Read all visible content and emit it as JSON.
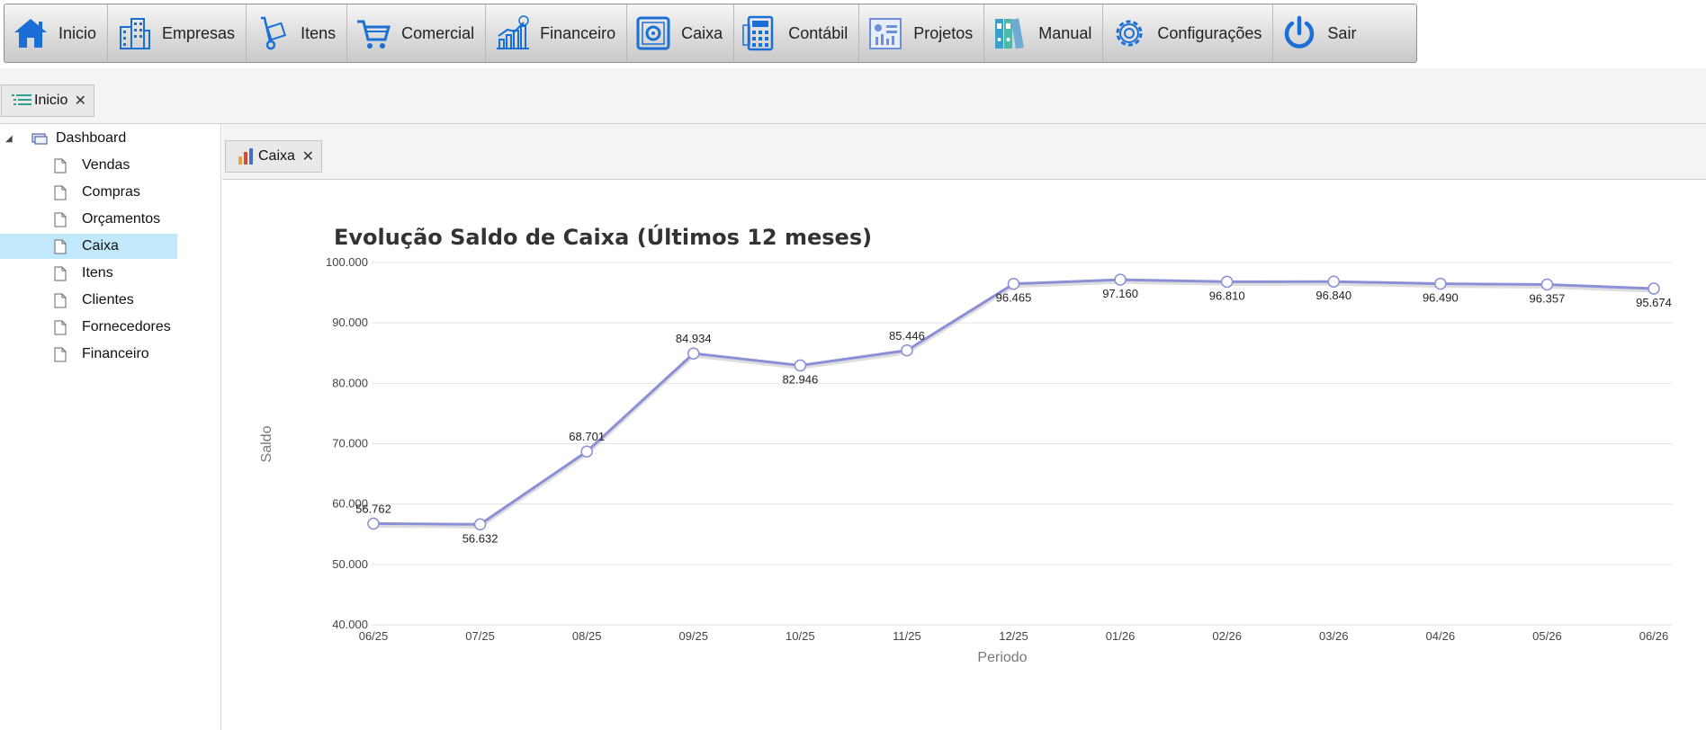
{
  "menubar": {
    "items": [
      {
        "label": "Inicio",
        "icon": "home-icon"
      },
      {
        "label": "Empresas",
        "icon": "buildings-icon"
      },
      {
        "label": "Itens",
        "icon": "hand-truck-icon"
      },
      {
        "label": "Comercial",
        "icon": "shopping-cart-icon"
      },
      {
        "label": "Financeiro",
        "icon": "growth-chart-icon"
      },
      {
        "label": "Caixa",
        "icon": "safe-icon"
      },
      {
        "label": "Contábil",
        "icon": "calculator-icon"
      },
      {
        "label": "Projetos",
        "icon": "project-board-icon"
      },
      {
        "label": "Manual",
        "icon": "binders-icon"
      },
      {
        "label": "Configurações",
        "icon": "gear-icon"
      },
      {
        "label": "Sair",
        "icon": "power-icon"
      }
    ]
  },
  "doc_tabs": [
    {
      "label": "Inicio",
      "icon": "list-icon"
    }
  ],
  "tree": {
    "root": {
      "label": "Dashboard",
      "icon": "dashboard-icon",
      "expanded": true
    },
    "children": [
      {
        "label": "Vendas",
        "selected": false
      },
      {
        "label": "Compras",
        "selected": false
      },
      {
        "label": "Orçamentos",
        "selected": false
      },
      {
        "label": "Caixa",
        "selected": true
      },
      {
        "label": "Itens",
        "selected": false
      },
      {
        "label": "Clientes",
        "selected": false
      },
      {
        "label": "Fornecedores",
        "selected": false
      },
      {
        "label": "Financeiro",
        "selected": false
      }
    ]
  },
  "chart_tab": {
    "label": "Caixa",
    "icon": "bar-chart-icon"
  },
  "chart_data": {
    "type": "line",
    "title": "Evolução Saldo de Caixa (Últimos 12 meses)",
    "xlabel": "Periodo",
    "ylabel": "Saldo",
    "categories": [
      "06/25",
      "07/25",
      "08/25",
      "09/25",
      "10/25",
      "11/25",
      "12/25",
      "01/26",
      "02/26",
      "03/26",
      "04/26",
      "05/26",
      "06/26"
    ],
    "values": [
      56762,
      56632,
      68701,
      84934,
      82946,
      85446,
      96465,
      97160,
      96810,
      96840,
      96490,
      96357,
      95674
    ],
    "value_labels": [
      "56.762",
      "56.632",
      "68.701",
      "84.934",
      "82.946",
      "85.446",
      "96.465",
      "97.160",
      "96.810",
      "96.840",
      "96.490",
      "96.357",
      "95.674"
    ],
    "ylim": [
      40000,
      100000
    ],
    "yticks": [
      40000,
      50000,
      60000,
      70000,
      80000,
      90000,
      100000
    ],
    "ytick_labels": [
      "40.000",
      "50.000",
      "60.000",
      "70.000",
      "80.000",
      "90.000",
      "100.000"
    ],
    "grid": true,
    "line_color": "#8a8fd6",
    "marker_fill": "#ffffff",
    "title_color": "#333333"
  }
}
